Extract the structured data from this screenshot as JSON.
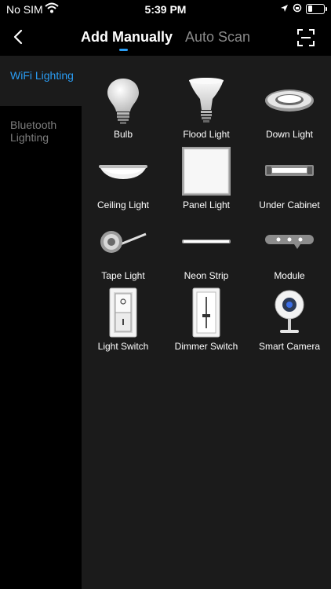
{
  "status": {
    "carrier": "No SIM",
    "time": "5:39 PM"
  },
  "header": {
    "tab_active": "Add Manually",
    "tab_inactive": "Auto Scan",
    "accent": "#2a9df4"
  },
  "sidebar": {
    "items": [
      {
        "label": "WiFi Lighting"
      },
      {
        "label": "Bluetooth Lighting"
      }
    ]
  },
  "devices": [
    {
      "label": "Bulb",
      "icon": "bulb-icon"
    },
    {
      "label": "Flood Light",
      "icon": "flood-light-icon"
    },
    {
      "label": "Down Light",
      "icon": "down-light-icon"
    },
    {
      "label": "Ceiling Light",
      "icon": "ceiling-light-icon"
    },
    {
      "label": "Panel Light",
      "icon": "panel-light-icon"
    },
    {
      "label": "Under Cabinet",
      "icon": "under-cabinet-icon"
    },
    {
      "label": "Tape Light",
      "icon": "tape-light-icon"
    },
    {
      "label": "Neon Strip",
      "icon": "neon-strip-icon"
    },
    {
      "label": "Module",
      "icon": "module-icon"
    },
    {
      "label": "Light Switch",
      "icon": "light-switch-icon"
    },
    {
      "label": "Dimmer Switch",
      "icon": "dimmer-switch-icon"
    },
    {
      "label": "Smart Camera",
      "icon": "smart-camera-icon"
    }
  ]
}
